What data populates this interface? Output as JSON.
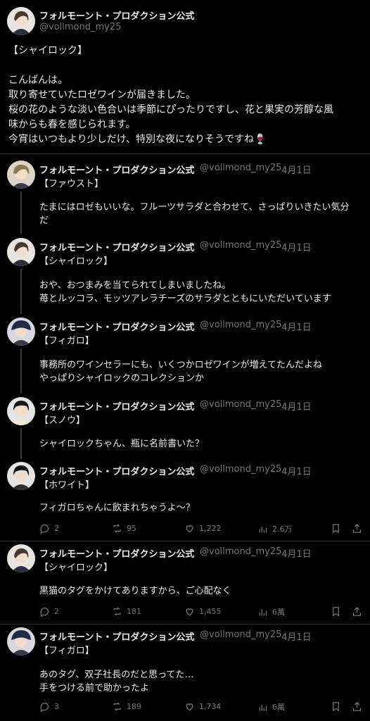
{
  "main": {
    "name": "フォルモーント・プロダクション公式",
    "handle": "@vollmond_my25",
    "text": "【シャイロック】\n\nこんばんは。\n取り寄せていたロゼワインが届きました。\n桜の花のような淡い色合いは季節にぴったりですし、花と果実の芳醇な風\n味からも春を感じられます。\n今宵はいつもより少しだけ、特別な夜になりそうですね🍷"
  },
  "replies": [
    {
      "name": "フォルモーント・プロダクション公式",
      "handle": "@vollmond_my25",
      "date": "· 4月1日",
      "tag": "【ファウスト】",
      "text": "たまにはロゼもいいな。フルーツサラダと合わせて、さっぱりいきたい気分\nだ"
    },
    {
      "name": "フォルモーント・プロダクション公式",
      "handle": "@vollmond_my25",
      "date": "· 4月1日",
      "tag": "【シャイロック】",
      "text": "おや、おつまみを当てられてしまいましたね。\n苺とルッコラ、モッツアレラチーズのサラダとともにいただいています"
    },
    {
      "name": "フォルモーント・プロダクション公式",
      "handle": "@vollmond_my25",
      "date": "· 4月1日",
      "tag": "【フィガロ】",
      "text": "事務所のワインセラーにも、いくつかロゼワインが増えてたんだよね\nやっぱりシャイロックのコレクションか"
    },
    {
      "name": "フォルモーント・プロダクション公式",
      "handle": "@vollmond_my25",
      "date": "· 4月1日",
      "tag": "【スノウ】",
      "text": "シャイロックちゃん、瓶に名前書いた？"
    },
    {
      "name": "フォルモーント・プロダクション公式",
      "handle": "@vollmond_my25",
      "date": "· 4月1日",
      "tag": "【ホワイト】",
      "text": "フィガロちゃんに飲まれちゃうよ～？",
      "stats": {
        "replies": "2",
        "retweets": "95",
        "likes": "1,222",
        "views": "2.6万"
      }
    },
    {
      "name": "フォルモーント・プロダクション公式",
      "handle": "@vollmond_my25",
      "date": "· 4月1日",
      "tag": "【シャイロック】",
      "text": "黒猫のタグをかけてありますから、ご心配なく",
      "stats": {
        "replies": "2",
        "retweets": "181",
        "likes": "1,455",
        "views": "6萬"
      }
    },
    {
      "name": "フォルモーント・プロダクション公式",
      "handle": "@vollmond_my25",
      "date": "· 4月1日",
      "tag": "【フィガロ】",
      "text": "あのタグ、双子社長のだと思ってた…\n手をつける前で助かったよ",
      "stats": {
        "replies": "3",
        "retweets": "189",
        "likes": "1,734",
        "views": "6萬"
      }
    }
  ],
  "icons": {
    "reply": "reply-icon",
    "retweet": "retweet-icon",
    "like": "heart-icon",
    "views": "views-icon",
    "bookmark": "bookmark-icon"
  },
  "colors": {
    "background": "#000000",
    "text": "#e7e9ea",
    "muted": "#71767b"
  }
}
